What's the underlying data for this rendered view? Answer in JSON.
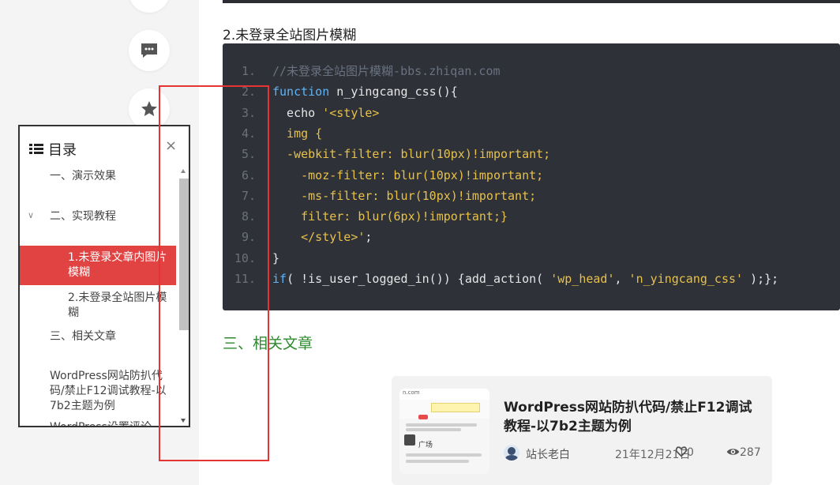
{
  "article": {
    "subheading": "2.未登录全站图片模糊",
    "section_title": "三、相关文章"
  },
  "code": {
    "lines": [
      {
        "n": "1.",
        "parts": [
          {
            "c": "cm",
            "t": "//未登录全站图片模糊-bbs.zhiqan.com"
          }
        ]
      },
      {
        "n": "2.",
        "parts": [
          {
            "c": "kw",
            "t": "function"
          },
          {
            "c": "df",
            "t": " n_yingcang_css(){"
          }
        ]
      },
      {
        "n": "3.",
        "parts": [
          {
            "c": "df",
            "t": "  echo "
          },
          {
            "c": "st",
            "t": "'<style>"
          }
        ]
      },
      {
        "n": "4.",
        "parts": [
          {
            "c": "st",
            "t": "  img {"
          }
        ]
      },
      {
        "n": "5.",
        "parts": [
          {
            "c": "st",
            "t": "  -webkit-filter: blur(10px)!important;"
          }
        ]
      },
      {
        "n": "6.",
        "parts": [
          {
            "c": "st",
            "t": "    -moz-filter: blur(10px)!important;"
          }
        ]
      },
      {
        "n": "7.",
        "parts": [
          {
            "c": "st",
            "t": "    -ms-filter: blur(10px)!important;"
          }
        ]
      },
      {
        "n": "8.",
        "parts": [
          {
            "c": "st",
            "t": "    filter: blur(6px)!important;}"
          }
        ]
      },
      {
        "n": "9.",
        "parts": [
          {
            "c": "st",
            "t": "    </style>'"
          },
          {
            "c": "df",
            "t": ";"
          }
        ]
      },
      {
        "n": "10.",
        "parts": [
          {
            "c": "df",
            "t": "}"
          }
        ]
      },
      {
        "n": "11.",
        "parts": [
          {
            "c": "kw",
            "t": "if"
          },
          {
            "c": "df",
            "t": "( !is_user_logged_in()) {add_action( "
          },
          {
            "c": "st",
            "t": "'wp_head'"
          },
          {
            "c": "df",
            "t": ", "
          },
          {
            "c": "st",
            "t": "'n_yingcang_css'"
          },
          {
            "c": "df",
            "t": " );};"
          }
        ]
      }
    ]
  },
  "related": {
    "title": "WordPress网站防扒代码/禁止F12调试教程-以7b2主题为例",
    "author": "站长老白",
    "date": "21年12月21日",
    "likes": "0",
    "views": "287",
    "thumb_text": "广场",
    "thumb_url": "n.com"
  },
  "toc": {
    "title": "目录",
    "close": "×",
    "items": [
      "一、演示效果",
      "二、实现教程",
      "1.未登录文章内图片模糊",
      "2.未登录全站图片模糊",
      "三、相关文章",
      "WordPress网站防扒代码/禁止F12调试教程-以7b2主题为例",
      "WordPress设置评论"
    ]
  },
  "icons": {
    "comment": "comment-icon",
    "star": "star-icon",
    "heart": "heart-icon",
    "eye": "eye-icon",
    "list": "list-icon"
  },
  "colors": {
    "accent": "#e14343",
    "section_green": "#2c8a2c",
    "code_bg": "#2e3138",
    "annotation": "#e53434"
  }
}
